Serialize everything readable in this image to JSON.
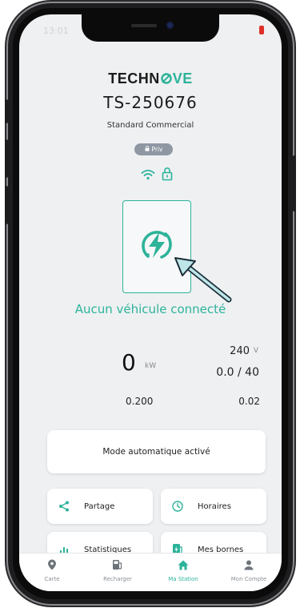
{
  "status_bar": {
    "left_text": "13:01"
  },
  "brand": {
    "name_part1": "TECHN",
    "name_part2": "VE",
    "accent_color": "#2db39a"
  },
  "station": {
    "id": "TS-250676",
    "type": "Standard Commercial",
    "badge": "Priv"
  },
  "charger": {
    "status": "Aucun véhicule connecté",
    "power_value": "0",
    "power_unit": "kW",
    "voltage_value": "240",
    "voltage_unit": "V",
    "current_value": "0.0 / 40",
    "energy_value": "0.200",
    "cost_value": "0.02"
  },
  "mode": {
    "label": "Mode automatique activé"
  },
  "menu": {
    "share_label": "Partage",
    "schedule_label": "Horaires",
    "stats_label": "Statistiques",
    "chargers_label": "Mes bornes"
  },
  "tabbar": {
    "map_label": "Carte",
    "recharge_label": "Recharger",
    "station_label": "Ma Station",
    "account_label": "Mon Compte"
  },
  "icons": [
    "share-icon",
    "clock-icon",
    "bar-chart-icon",
    "charger-icon",
    "map-pin-icon",
    "fuel-icon",
    "home-icon",
    "user-icon",
    "wifi-icon",
    "padlock-icon",
    "lightning-bolt-icon"
  ]
}
